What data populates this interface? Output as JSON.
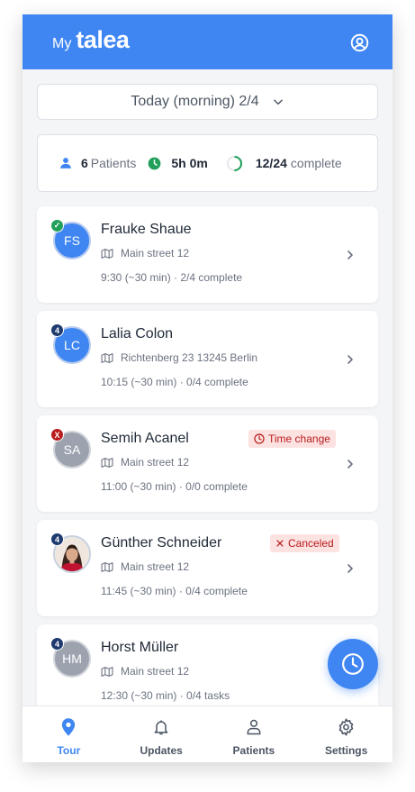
{
  "header": {
    "prefix": "My",
    "brand": "talea",
    "profile_icon": "user-circle-icon",
    "color": "#3f86f2"
  },
  "selector": {
    "label": "Today (morning) 2/4",
    "icon": "chevron-down-icon"
  },
  "summary": {
    "patients_count": "6",
    "patients_label": "Patients",
    "duration": "5h 0m",
    "progress": "12/24",
    "progress_label": "complete",
    "progress_fraction": 0.5
  },
  "tour": [
    {
      "initials": "FS",
      "name": "Frauke Shaue",
      "address": "Main street 12",
      "meta": "9:30 (~30 min) · 2/4 complete",
      "badge": "✓",
      "badge_type": "ok",
      "avatar": "blue",
      "tag": ""
    },
    {
      "initials": "LC",
      "name": "Lalia Colon",
      "address": "Richtenberg 23 13245 Berlin",
      "meta": "10:15 (~30 min) · 0/4 complete",
      "badge": "4",
      "badge_type": "num",
      "avatar": "blue",
      "tag": ""
    },
    {
      "initials": "SA",
      "name": "Semih Acanel",
      "address": "Main street 12",
      "meta": "11:00 (~30 min) · 0/0 complete",
      "badge": "X",
      "badge_type": "x",
      "avatar": "gray",
      "tag": "Time change"
    },
    {
      "initials": "",
      "name": "Günther Schneider",
      "address": "Main street 12",
      "meta": "11:45 (~30 min) · 0/4 complete",
      "badge": "4",
      "badge_type": "num",
      "avatar": "photo",
      "tag": "Canceled"
    },
    {
      "initials": "HM",
      "name": "Horst Müller",
      "address": "Main street 12",
      "meta": "12:30 (~30 min) · 0/4 tasks",
      "badge": "4",
      "badge_type": "num",
      "avatar": "gray",
      "tag": ""
    }
  ],
  "nav": [
    {
      "label": "Tour",
      "icon": "location-pin-icon",
      "active": true
    },
    {
      "label": "Updates",
      "icon": "bell-icon",
      "active": false
    },
    {
      "label": "Patients",
      "icon": "person-icon",
      "active": false
    },
    {
      "label": "Settings",
      "icon": "gear-icon",
      "active": false
    }
  ],
  "fab": {
    "icon": "clock-icon"
  }
}
